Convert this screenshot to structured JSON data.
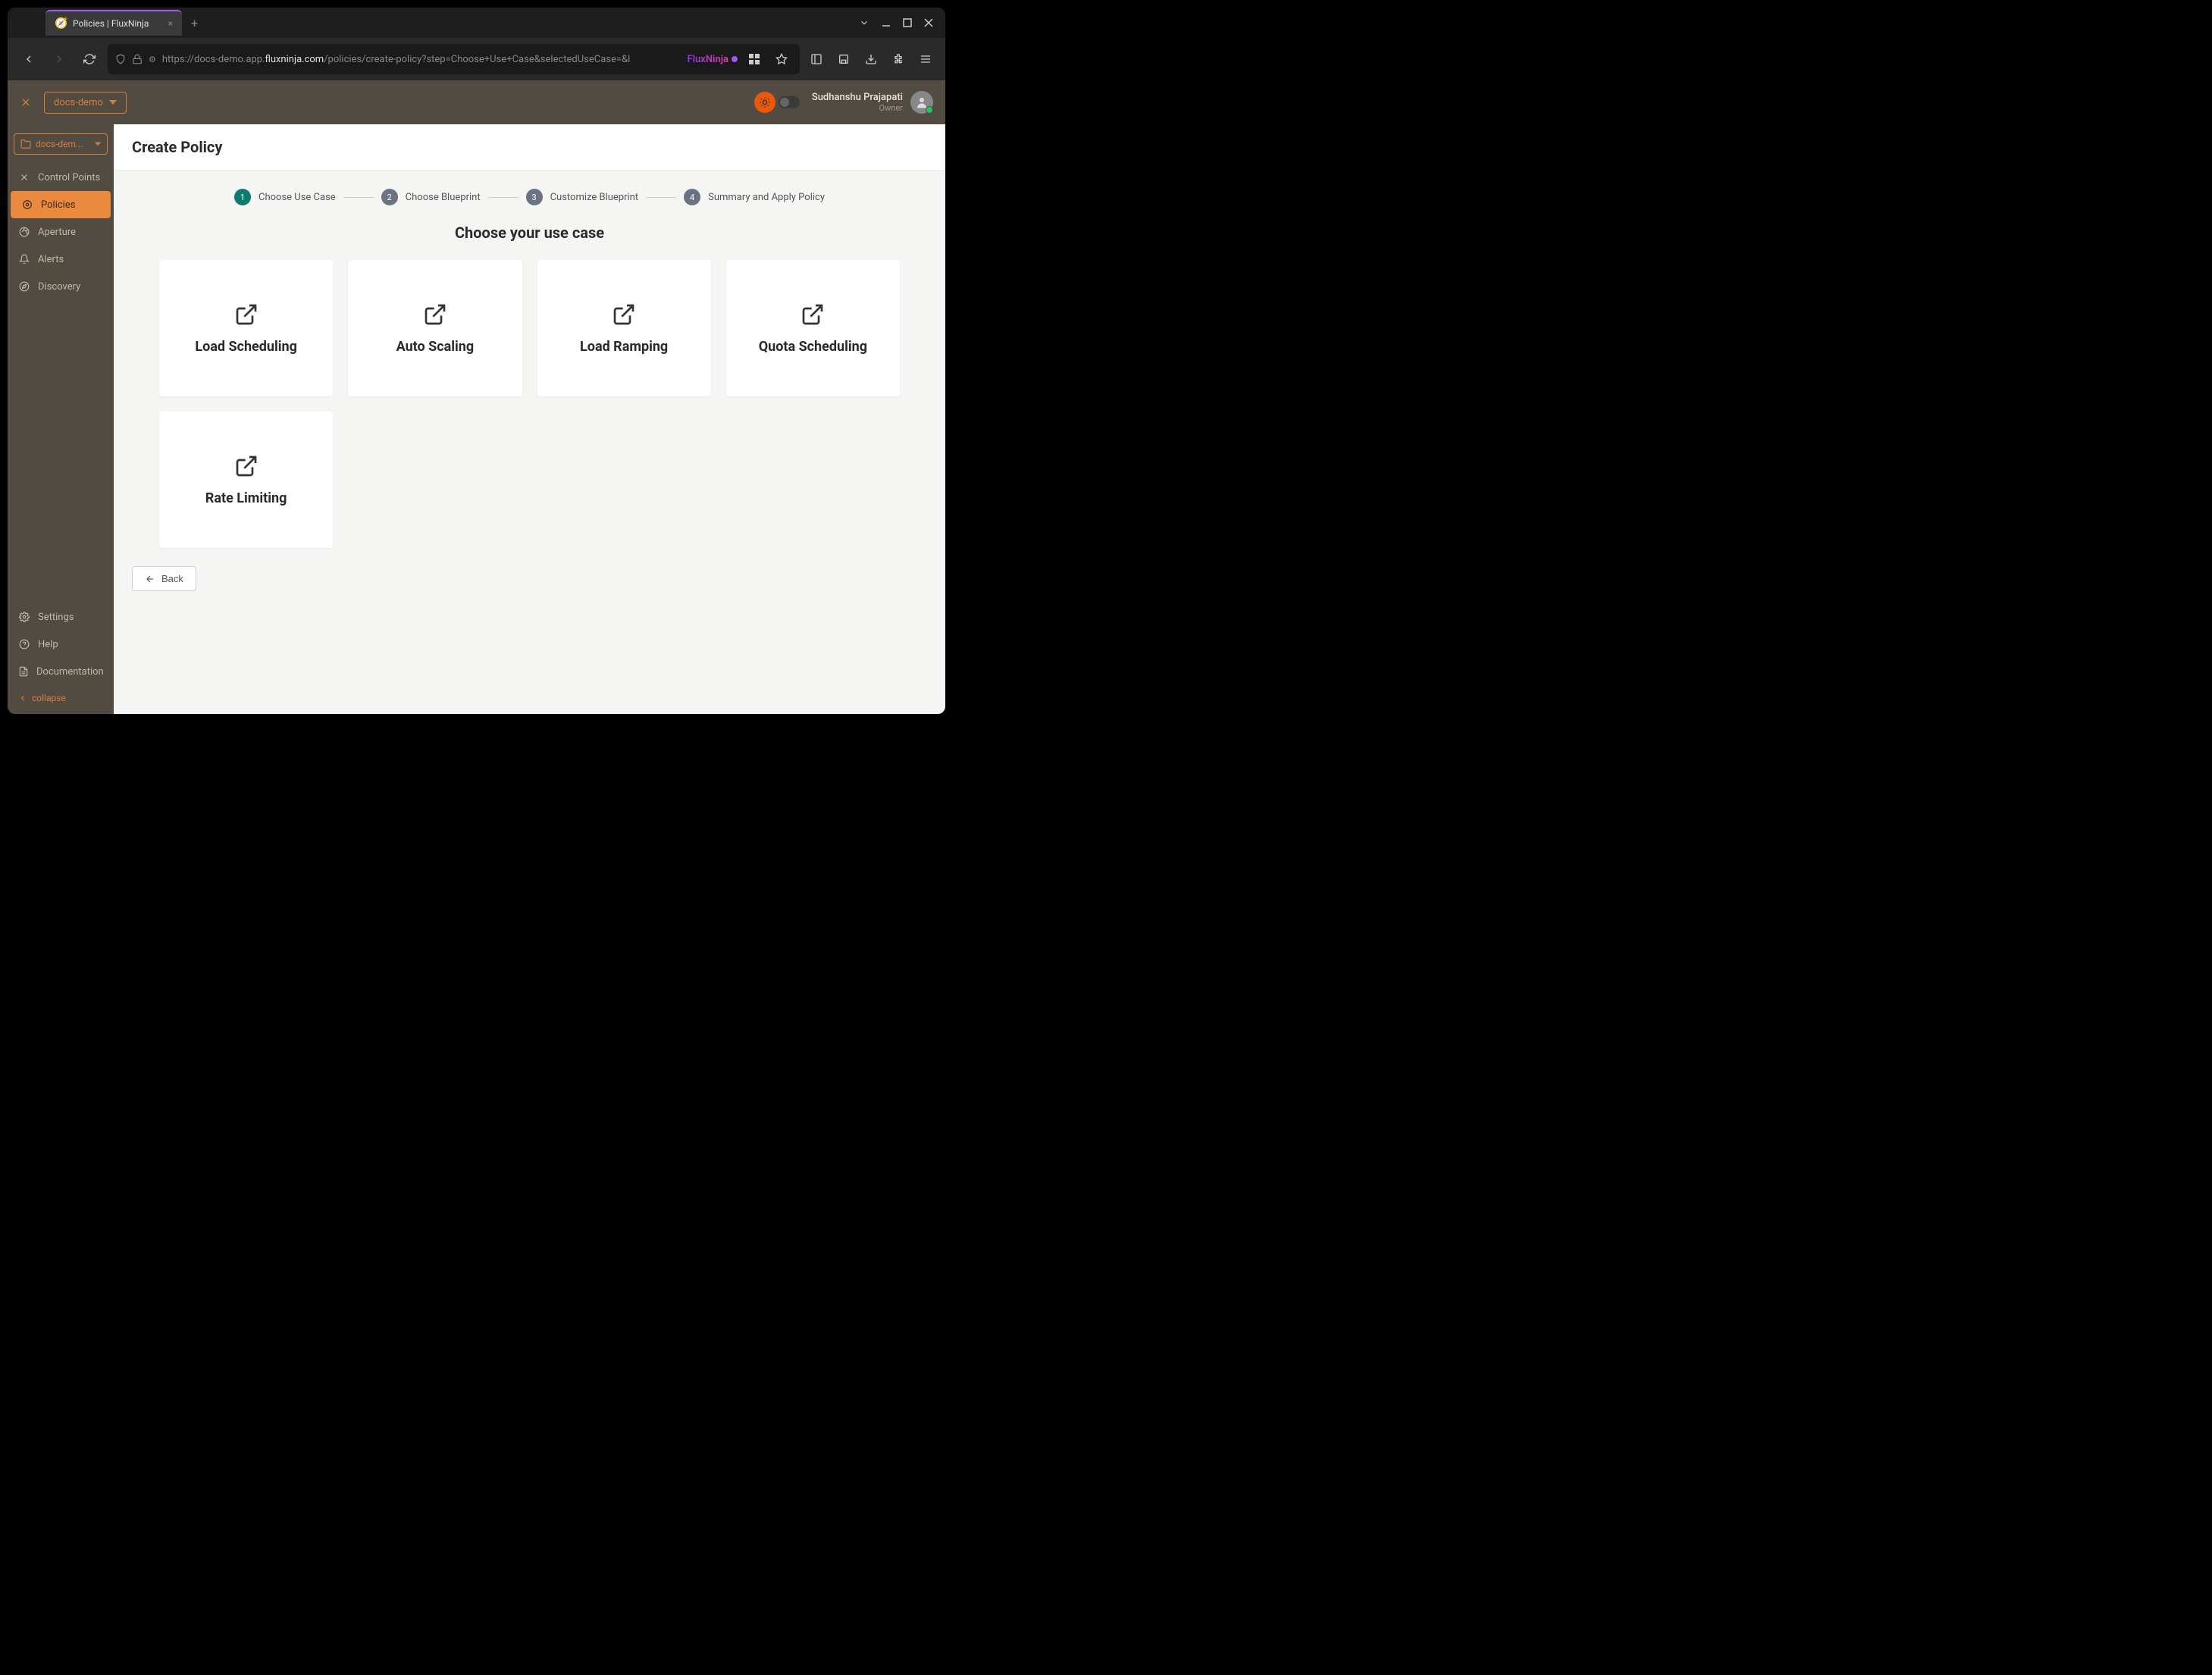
{
  "browser": {
    "tab_title": "Policies | FluxNinja",
    "url_protocol": "https://",
    "url_subdomain": "docs-demo.app.",
    "url_domain": "fluxninja.com",
    "url_path": "/policies/create-policy?step=Choose+Use+Case&selectedUseCase=&l",
    "brand_badge": "FluxNinja"
  },
  "header": {
    "project_name": "docs-demo",
    "user_name": "Sudhanshu Prajapati",
    "user_role": "Owner"
  },
  "sidebar": {
    "folder_name": "docs-dem...",
    "items": [
      {
        "label": "Control Points"
      },
      {
        "label": "Policies"
      },
      {
        "label": "Aperture"
      },
      {
        "label": "Alerts"
      },
      {
        "label": "Discovery"
      }
    ],
    "bottom_items": [
      {
        "label": "Settings"
      },
      {
        "label": "Help"
      },
      {
        "label": "Documentation"
      }
    ],
    "collapse_label": "collapse"
  },
  "page": {
    "title": "Create Policy",
    "section_title": "Choose your use case",
    "steps": [
      {
        "number": "1",
        "label": "Choose Use Case"
      },
      {
        "number": "2",
        "label": "Choose Blueprint"
      },
      {
        "number": "3",
        "label": "Customize Blueprint"
      },
      {
        "number": "4",
        "label": "Summary and Apply Policy"
      }
    ],
    "use_cases": [
      {
        "title": "Load Scheduling"
      },
      {
        "title": "Auto Scaling"
      },
      {
        "title": "Load Ramping"
      },
      {
        "title": "Quota Scheduling"
      },
      {
        "title": "Rate Limiting"
      }
    ],
    "back_label": "Back"
  }
}
